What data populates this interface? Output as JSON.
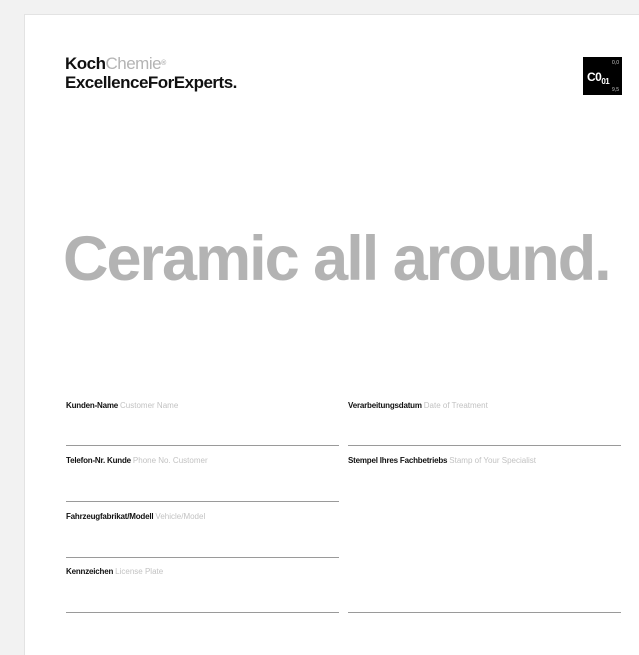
{
  "logo": {
    "brand_part1": "Koch",
    "brand_part2": "Chemie",
    "registered": "®",
    "tagline": "ExcellenceForExperts."
  },
  "badge": {
    "top_value": "0,0",
    "code": "C0",
    "code_sub": "01",
    "bottom_value": "9,5"
  },
  "headline": "Ceramic all around.",
  "fields": {
    "customer_name": {
      "label_de": "Kunden-Name",
      "label_en": "Customer Name"
    },
    "treatment_date": {
      "label_de": "Verarbeitungsdatum",
      "label_en": "Date of Treatment"
    },
    "phone": {
      "label_de": "Telefon-Nr. Kunde",
      "label_en": "Phone No. Customer"
    },
    "stamp": {
      "label_de": "Stempel Ihres Fachbetriebs",
      "label_en": "Stamp of Your Specialist"
    },
    "vehicle": {
      "label_de": "Fahrzeugfabrikat/Modell",
      "label_en": "Vehicle/Model"
    },
    "plate": {
      "label_de": "Kennzeichen",
      "label_en": "License Plate"
    }
  },
  "colors": {
    "headline": "#b3b3b3",
    "accent_text": "#111111",
    "secondary_text": "#c2c2c2",
    "badge_bg": "#000000"
  }
}
